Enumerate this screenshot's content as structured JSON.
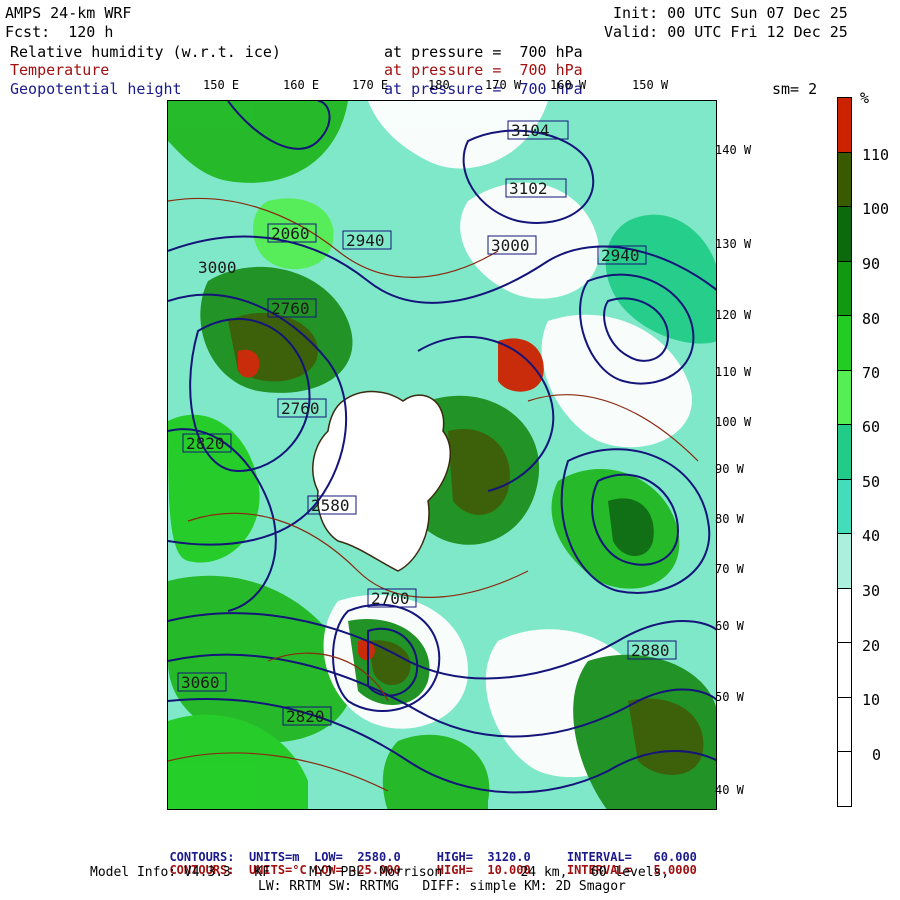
{
  "header": {
    "model": "AMPS 24-km WRF",
    "fcst": "Fcst:  120 h",
    "init": "Init: 00 UTC Sun 07 Dec 25",
    "valid": "Valid: 00 UTC Fri 12 Dec 25"
  },
  "fields": [
    {
      "name": "Relative humidity (w.r.t. ice)",
      "level": "at pressure =  700 hPa",
      "color": "#000000"
    },
    {
      "name": "Temperature",
      "level": "at pressure =  700 hPa",
      "color": "#a01010"
    },
    {
      "name": "Geopotential height",
      "level": "at pressure =  700 hPa",
      "color": "#1a1a8c"
    }
  ],
  "smoothing": "sm= 2",
  "lon_labels_top": [
    "150 E",
    "160 E",
    "170 E",
    "180",
    "170 W",
    "160 W",
    "150 W"
  ],
  "lon_labels_right": [
    "140 W",
    "130 W",
    "120 W",
    "110 W",
    "100 W",
    "90 W",
    "80 W",
    "70 W",
    "60 W",
    "50 W",
    "40 W"
  ],
  "colorbar": {
    "unit": "%",
    "labels": [
      "110",
      "100",
      "90",
      "80",
      "70",
      "60",
      "50",
      "40",
      "30",
      "20",
      "10",
      "0"
    ],
    "colors": [
      "#cc2200",
      "#3a5a00",
      "#0c6a0c",
      "#119a11",
      "#22cc22",
      "#55ee55",
      "#22cc88",
      "#44ddbb",
      "#aaf0dd",
      "#ffffff",
      "#ffffff",
      "#ffffff",
      "#ffffff"
    ]
  },
  "map_labels": [
    {
      "text": "2060"
    },
    {
      "text": "2940"
    },
    {
      "text": "3000"
    },
    {
      "text": "2760"
    },
    {
      "text": "2820"
    },
    {
      "text": "2700"
    },
    {
      "text": "2880"
    },
    {
      "text": "3060"
    },
    {
      "text": "2820"
    },
    {
      "text": "2580"
    },
    {
      "text": "3104"
    },
    {
      "text": "3102"
    },
    {
      "text": "2760"
    },
    {
      "text": "2940"
    },
    {
      "text": "3000"
    }
  ],
  "footer": {
    "height_line": {
      "prefix": "CONTOURS:",
      "units": "UNITS=m",
      "low": "LOW=  2580.0",
      "high": "HIGH=  3120.0",
      "interval": "INTERVAL=   60.000"
    },
    "temp_line": {
      "prefix": "CONTOURS:",
      "units": "UNITS=°C",
      "low": "LOW= -25.000",
      "high": "HIGH=  10.000",
      "interval": "INTERVAL=   5.0000"
    },
    "model_info": "Model Info: V4.3.3   KF     MYJ PBL  Morrison          24 km,   60 levels,",
    "physics": "LW: RRTM SW: RRTMG   DIFF: simple KM: 2D Smagor"
  }
}
